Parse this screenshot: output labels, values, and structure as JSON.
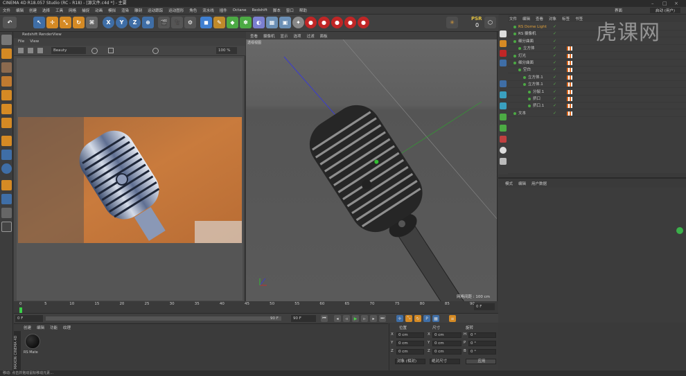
{
  "window": {
    "title": "CINEMA 4D R18.057 Studio (RC - R18) - [源文件.c4d *] - 主要"
  },
  "menu": [
    "文件",
    "编辑",
    "创建",
    "选择",
    "工具",
    "网格",
    "捕捉",
    "动画",
    "模拟",
    "渲染",
    "雕刻",
    "运动跟踪",
    "运动图形",
    "角色",
    "流水线",
    "插件",
    "Octane",
    "Redshift",
    "脚本",
    "窗口",
    "帮助"
  ],
  "toolbar": {
    "axis": [
      "X",
      "Y",
      "Z"
    ],
    "psr_label": "PSR",
    "psr_value": "0"
  },
  "right_header": {
    "layout_label": "界面",
    "layout_value": "启动 (用户)"
  },
  "renderview": {
    "title": "Redshift RenderView",
    "menu": [
      "File",
      "View"
    ],
    "mode": "Beauty",
    "zoom": "100 %"
  },
  "viewport": {
    "menu": [
      "查看",
      "摄像机",
      "显示",
      "选项",
      "过滤",
      "面板"
    ],
    "tag": "透视视图",
    "grid_label": "网格间距 : 100 cm"
  },
  "object_manager": {
    "tabs": [
      "文件",
      "编辑",
      "查看",
      "对象",
      "标签",
      "书签"
    ],
    "rows": [
      {
        "name": "RS Dome Light",
        "indent": 0,
        "color": "#e0a03a"
      },
      {
        "name": "RS 摄像机",
        "indent": 0,
        "color": "#ccc"
      },
      {
        "name": "细分曲面",
        "indent": 0,
        "color": "#ccc"
      },
      {
        "name": "立方体",
        "indent": 1,
        "color": "#ccc"
      },
      {
        "name": "灯光",
        "indent": 0,
        "color": "#ccc"
      },
      {
        "name": "细分曲面",
        "indent": 0,
        "color": "#ccc"
      },
      {
        "name": "空白",
        "indent": 1,
        "color": "#ccc"
      },
      {
        "name": "立方体.1",
        "indent": 2,
        "color": "#ccc"
      },
      {
        "name": "立方体.1",
        "indent": 2,
        "color": "#ccc"
      },
      {
        "name": "分裂.1",
        "indent": 3,
        "color": "#ccc"
      },
      {
        "name": "挤口",
        "indent": 3,
        "color": "#ccc"
      },
      {
        "name": "挤口.1",
        "indent": 3,
        "color": "#ccc"
      },
      {
        "name": "文本",
        "indent": 0,
        "color": "#ccc"
      }
    ]
  },
  "attributes": {
    "tabs": [
      "模式",
      "编辑",
      "用户数据"
    ]
  },
  "timeline": {
    "ticks": [
      "0",
      "5",
      "10",
      "15",
      "20",
      "25",
      "30",
      "35",
      "40",
      "45",
      "50",
      "55",
      "60",
      "65",
      "70",
      "75",
      "80",
      "85",
      "90"
    ],
    "current": "0 F",
    "start": "0 F",
    "end_a": "90 F",
    "end_b": "90 F"
  },
  "materials": {
    "tabs": [
      "创建",
      "编辑",
      "功能",
      "纹理"
    ],
    "items": [
      {
        "name": "RS Mate"
      }
    ]
  },
  "coordinates": {
    "headers": [
      "位置",
      "尺寸",
      "旋转"
    ],
    "rows": [
      {
        "axis": "X",
        "pos": "0 cm",
        "size_axis": "X",
        "size": "0 cm",
        "rot_axis": "H",
        "rot": "0 °"
      },
      {
        "axis": "Y",
        "pos": "0 cm",
        "size_axis": "Y",
        "size": "0 cm",
        "rot_axis": "P",
        "rot": "0 °"
      },
      {
        "axis": "Z",
        "pos": "0 cm",
        "size_axis": "Z",
        "size": "0 cm",
        "rot_axis": "B",
        "rot": "0 °"
      }
    ],
    "mode": "对象 (相对)",
    "size_mode": "绝对尺寸",
    "apply": "应用"
  },
  "status": "移动: 点击并拖动鼠标移动元素...",
  "brand": "MAXON CINEMA 4D",
  "watermark": "虎课网"
}
